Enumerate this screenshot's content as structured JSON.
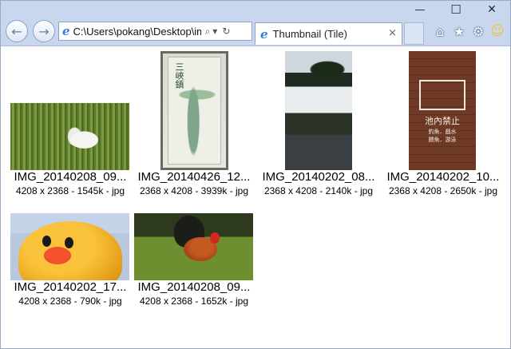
{
  "window": {
    "controls": {
      "minimize": "—",
      "maximize": "☐",
      "close": "✕"
    }
  },
  "toolbar": {
    "back_icon": "arrow-left-icon",
    "forward_icon": "arrow-right-icon",
    "back_glyph": "←",
    "forward_glyph": "→",
    "address": "C:\\Users\\pokang\\Desktop\\im",
    "search_glyph": "⌕",
    "dropdown_glyph": "▾",
    "refresh_glyph": "↻",
    "ie_glyph": "e"
  },
  "tab": {
    "title": "Thumbnail (Tile)",
    "close_glyph": "×"
  },
  "right_icons": {
    "home": "⌂",
    "favorites": "★",
    "tools": "⚙",
    "feedback": "☺"
  },
  "colors": {
    "chrome": "#c9d7ee",
    "border": "#9aa9c6",
    "ie_blue": "#2f7fd3"
  },
  "tiles": [
    {
      "name": "IMG_20140208_09...",
      "info": "4208 x 2368 - 1545k - jpg",
      "thumb": "goose"
    },
    {
      "name": "IMG_20140426_12...",
      "info": "2368 x 4208 - 3939k - jpg",
      "thumb": "map"
    },
    {
      "name": "IMG_20140202_08...",
      "info": "2368 x 4208 - 2140k - jpg",
      "thumb": "house"
    },
    {
      "name": "IMG_20140202_10...",
      "info": "2368 x 4208 - 2650k - jpg",
      "thumb": "sign"
    },
    {
      "name": "IMG_20140202_17...",
      "info": "4208 x 2368 - 790k - jpg",
      "thumb": "duck"
    },
    {
      "name": "IMG_20140208_09...",
      "info": "4208 x 2368 - 1652k - jpg",
      "thumb": "rooster"
    }
  ],
  "sign_text": {
    "title": "池內禁止",
    "line1": "釣魚．戲水",
    "line2": "餵魚．游泳"
  },
  "map_text": "三峽鎮"
}
